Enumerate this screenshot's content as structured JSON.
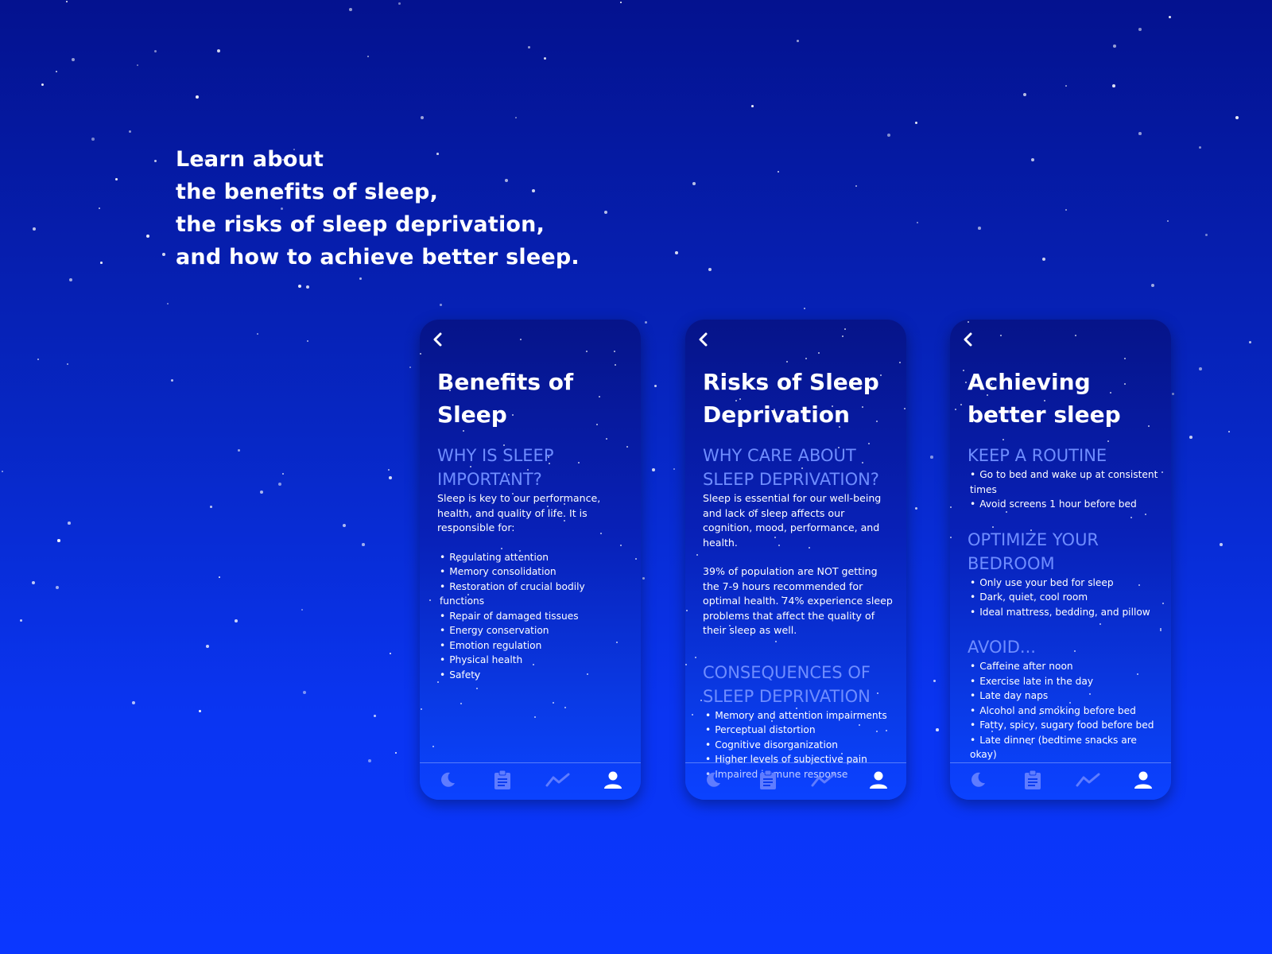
{
  "headline": {
    "lines": [
      "Learn about",
      "the benefits of sleep,",
      "the risks of sleep deprivation,",
      "and how to achieve better sleep."
    ]
  },
  "colors": {
    "section_heading": "#6f8dff",
    "nav_icon_inactive": "#5f7cff",
    "nav_icon_active": "#ffffff"
  },
  "icons": {
    "back": "chevron-left-icon",
    "nav": [
      "moon-icon",
      "clipboard-icon",
      "trend-chart-icon",
      "person-icon"
    ]
  },
  "screens": [
    {
      "title": "Benefits of Sleep",
      "sections": [
        {
          "heading": "WHY IS SLEEP IMPORTANT?",
          "paragraphs": [
            "Sleep is key to our performance, health, and quality of life. It is responsible for:"
          ],
          "bullets": [
            "Regulating attention",
            "Memory consolidation",
            "Restoration of crucial bodily functions",
            "Repair of damaged tissues",
            "Energy conservation",
            "Emotion regulation",
            "Physical health",
            "Safety"
          ]
        }
      ]
    },
    {
      "title": "Risks of Sleep Deprivation",
      "sections": [
        {
          "heading": "WHY CARE ABOUT SLEEP DEPRIVATION?",
          "paragraphs": [
            "Sleep is essential for our well-being and lack of sleep affects our cognition, mood, performance, and health.",
            "39% of population are NOT getting the 7-9 hours recommended for optimal health. 74% experience sleep problems that affect the quality of their sleep as well."
          ],
          "bullets": []
        },
        {
          "heading": "CONSEQUENCES OF SLEEP DEPRIVATION",
          "paragraphs": [],
          "bullets": [
            "Memory and attention impairments",
            "Perceptual distortion",
            "Cognitive disorganization",
            "Higher levels of subjective pain",
            "Impaired immune response"
          ]
        }
      ]
    },
    {
      "title": "Achieving better sleep",
      "sections": [
        {
          "heading": "KEEP A ROUTINE",
          "paragraphs": [],
          "bullets": [
            "Go to bed and wake up at consistent times",
            "Avoid screens 1 hour before bed"
          ]
        },
        {
          "heading": "OPTIMIZE YOUR BEDROOM",
          "paragraphs": [],
          "bullets": [
            "Only use your bed for sleep",
            "Dark, quiet, cool room",
            "Ideal mattress, bedding, and pillow"
          ]
        },
        {
          "heading": "AVOID...",
          "paragraphs": [],
          "bullets": [
            "Caffeine after noon",
            "Exercise late in the day",
            "Late day naps",
            "Alcohol and smoking before bed",
            "Fatty, spicy, sugary food before bed",
            "Late dinner (bedtime snacks are okay)"
          ]
        }
      ]
    }
  ]
}
